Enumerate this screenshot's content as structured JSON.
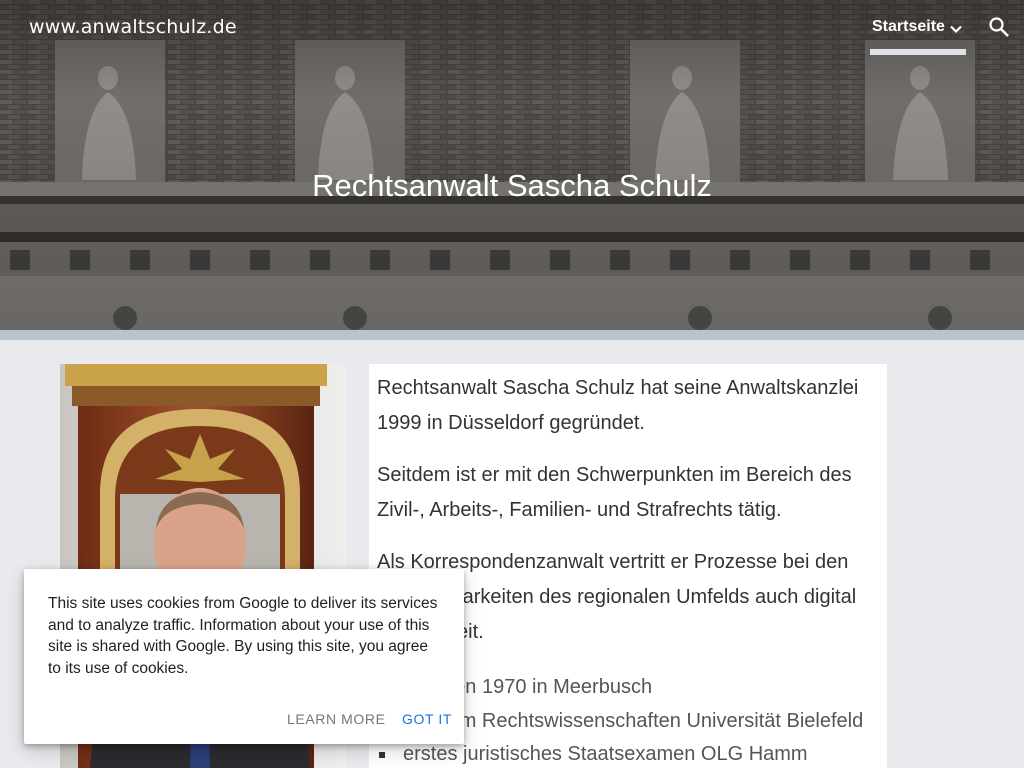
{
  "header": {
    "site_title": "www.anwaltschulz.de",
    "nav_item": "Startseite",
    "page_title": "Rechtsanwalt Sascha Schulz"
  },
  "icons": {
    "nav_dropdown": "chevron-down-icon",
    "search": "search-icon"
  },
  "main": {
    "paragraphs": [
      "Rechtsanwalt Sascha Schulz hat seine Anwaltskanzlei 1999 in Düsseldorf gegründet.",
      "Seitdem ist er mit den Schwerpunkten im Bereich des Zivil-, Arbeits-, Familien- und Strafrechts tätig.",
      "Als Korrespondenzanwalt vertritt er Prozesse bei den Gerichtsbarkeiten des regionalen Umfelds auch digital bundesweit."
    ],
    "cv_items": [
      "geboren 1970 in Meerbusch",
      "Studium Rechtswissenschaften Universität Bielefeld",
      "erstes juristisches Staatsexamen OLG Hamm"
    ]
  },
  "cookie_notice": {
    "text": "This site uses cookies from Google to deliver its services and to analyze traffic. Information about your use of this site is shared with Google. By using this site, you agree to its use of cookies.",
    "learn_more": "LEARN MORE",
    "got_it": "GOT IT"
  },
  "colors": {
    "header_text": "#ffffff",
    "content_background": "#e8eaed",
    "accent_link": "#1a73e8"
  }
}
